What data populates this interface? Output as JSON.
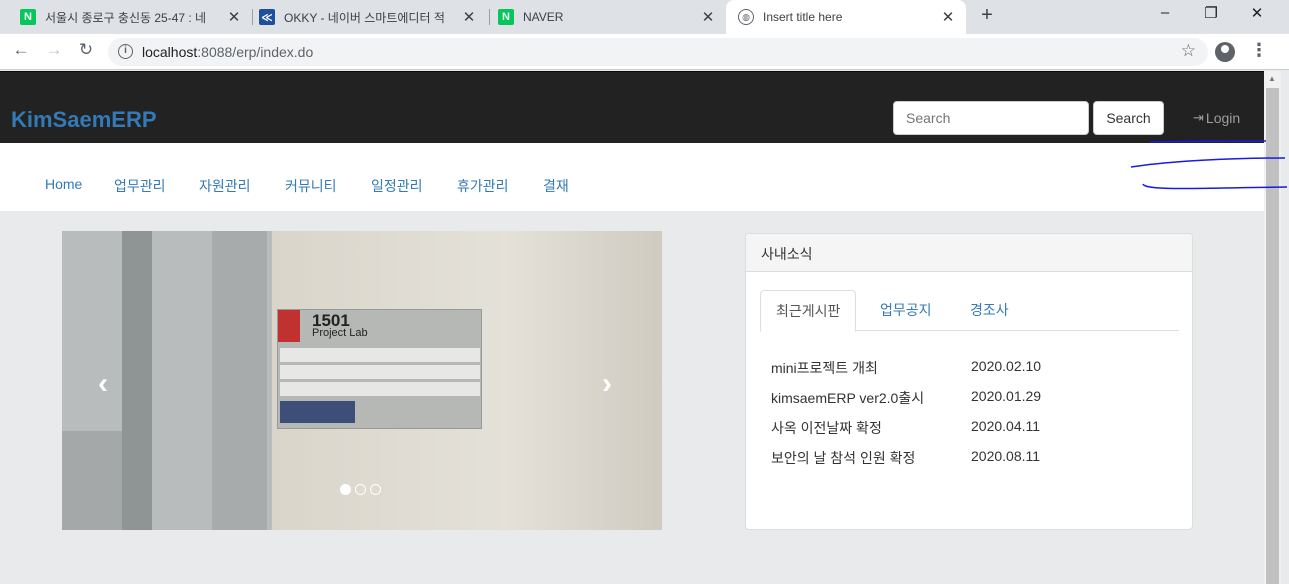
{
  "browser": {
    "tabs": [
      {
        "title": "서울시 종로구 충신동 25-47 : 네",
        "favicon": "naver-icon",
        "color": "#03c75a",
        "glyph": "N"
      },
      {
        "title": "OKKY - 네이버 스마트에디터 적",
        "favicon": "okky-icon",
        "color": "#1f4e9c",
        "glyph": "≪"
      },
      {
        "title": "NAVER",
        "favicon": "naver-icon",
        "color": "#03c75a",
        "glyph": "N"
      },
      {
        "title": "Insert title here",
        "favicon": "globe-icon",
        "color": "#5f6368",
        "glyph": ""
      }
    ],
    "url_host": "localhost",
    "url_rest": ":8088/erp/index.do"
  },
  "navbar": {
    "brand": "KimSaemERP",
    "search_placeholder": "Search",
    "search_button": "Search",
    "login_label": "Login"
  },
  "menu": [
    "Home",
    "업무관리",
    "자원관리",
    "커뮤니티",
    "일정관리",
    "휴가관리",
    "결재"
  ],
  "carousel": {
    "sign_number": "1501",
    "sign_name": "Project Lab",
    "slide_count": 3,
    "active_slide": 1
  },
  "panel": {
    "heading": "사내소식",
    "tabs": [
      "최근게시판",
      "업무공지",
      "경조사"
    ],
    "active_tab": 0,
    "news": [
      {
        "title": "mini프로젝트 개최",
        "date": "2020.02.10"
      },
      {
        "title": "kimsaemERP ver2.0출시",
        "date": "2020.01.29"
      },
      {
        "title": "사옥 이전날짜 확정",
        "date": "2020.04.11"
      },
      {
        "title": "보안의 날 참석 인원 확정",
        "date": "2020.08.11"
      }
    ]
  }
}
